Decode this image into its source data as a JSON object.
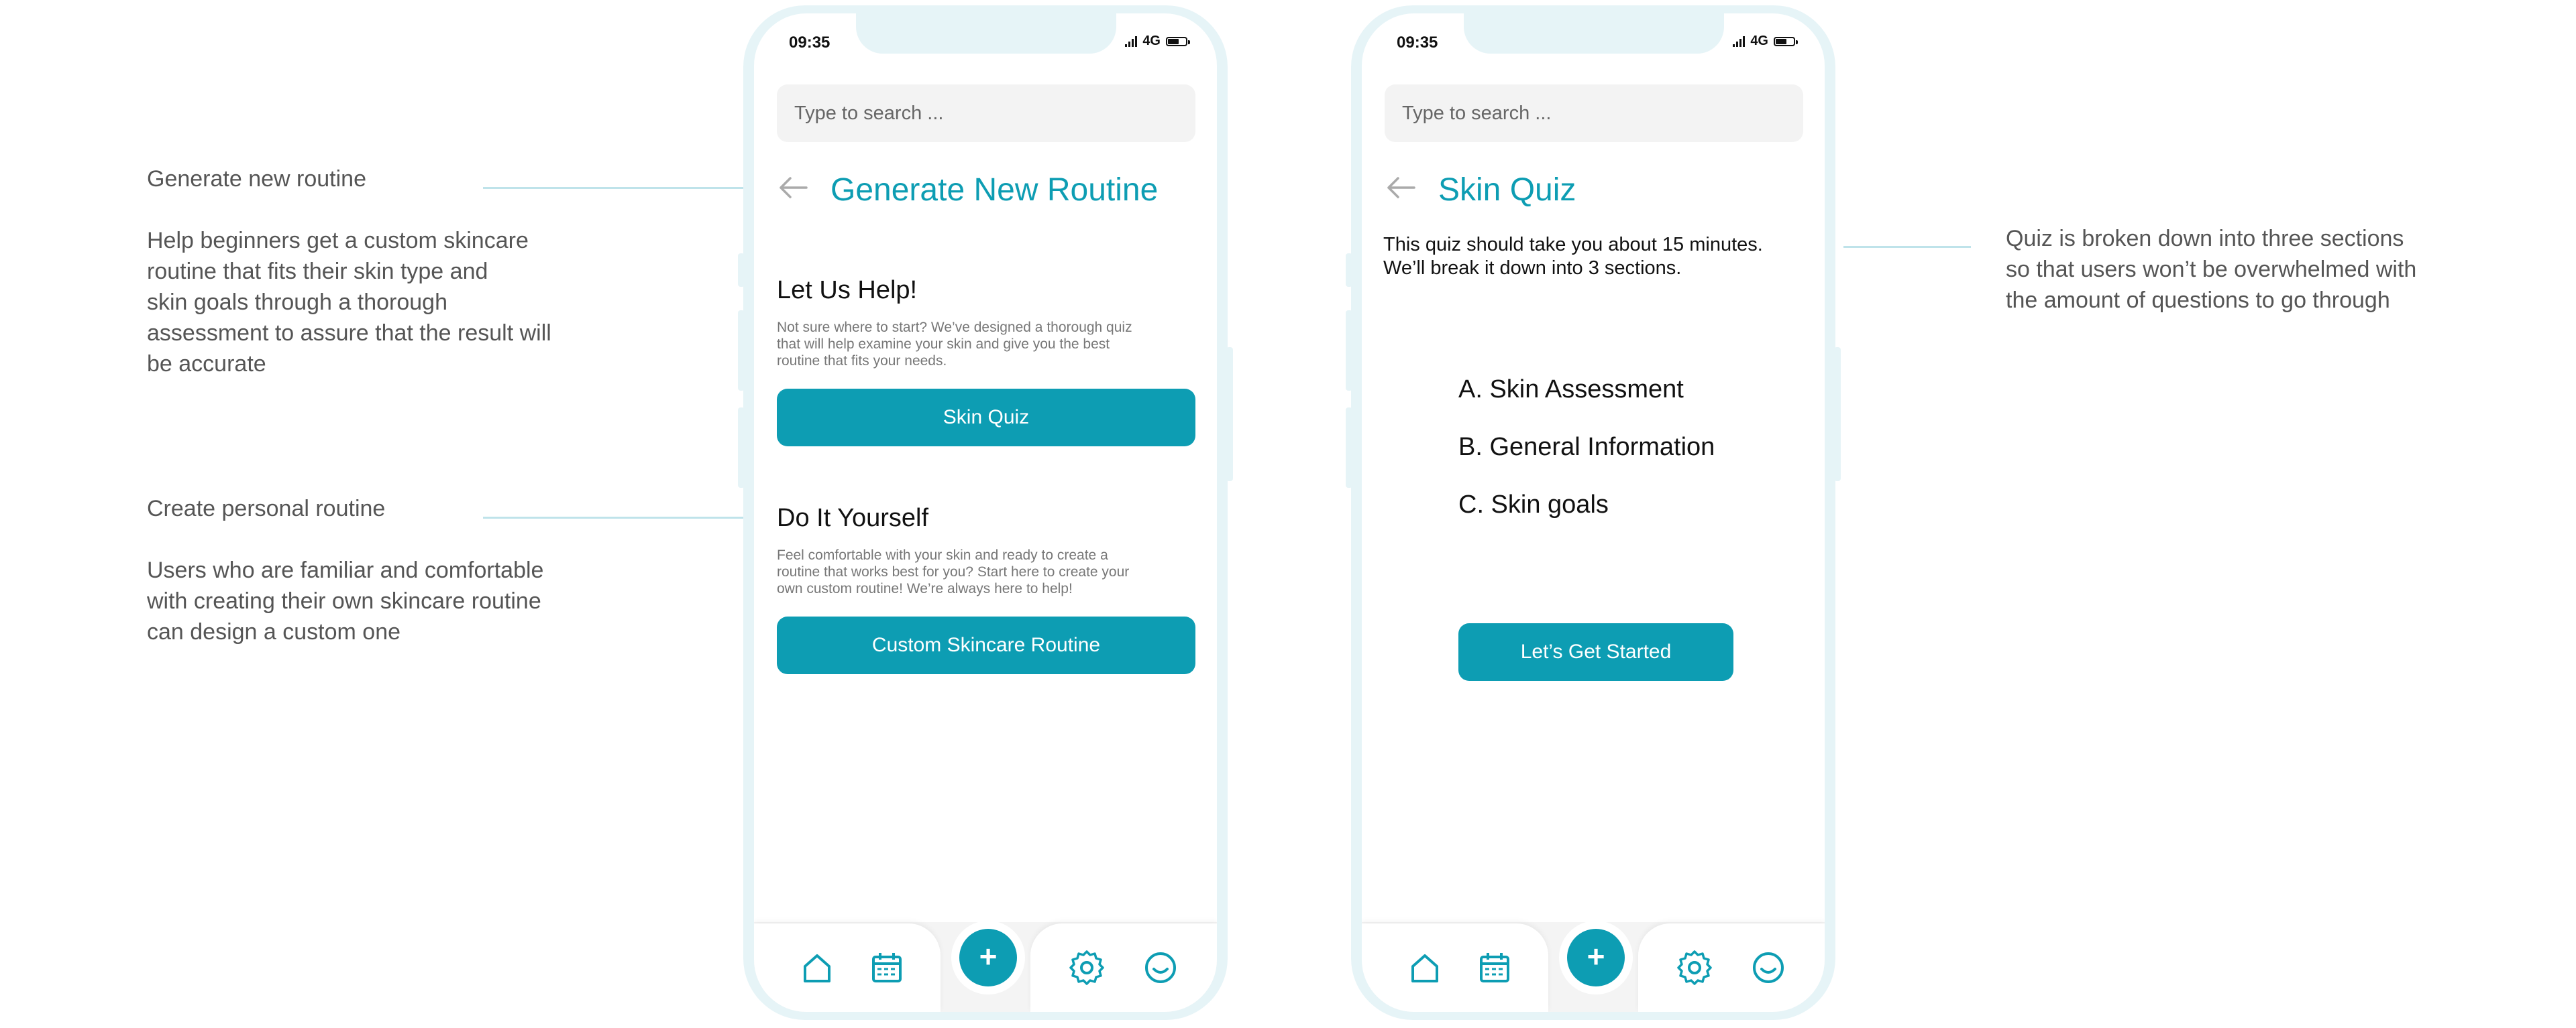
{
  "annotations": {
    "left": [
      {
        "title": "Generate new routine",
        "lines": [
          "Help beginners get a custom skincare",
          "routine that fits their skin type and",
          "skin goals through a thorough",
          "assessment to assure that the result will",
          "be accurate"
        ]
      },
      {
        "title": "Create personal routine",
        "lines": [
          "Users who are familiar and comfortable",
          "with creating their own skincare routine",
          "can design a custom one"
        ]
      }
    ],
    "right": {
      "lines": [
        "Quiz is broken down into three sections",
        "so that users won’t be overwhelmed with",
        "the amount of questions to go through"
      ]
    }
  },
  "status_bar": {
    "time": "09:35",
    "network": "4G"
  },
  "screen1": {
    "search_placeholder": "Type to search ...",
    "title": "Generate New Routine",
    "section1": {
      "heading": "Let Us Help!",
      "desc_lines": [
        "Not sure where to start? We’ve designed a thorough quiz",
        "that will help examine your skin and give you the best",
        "routine that fits your needs."
      ],
      "button": "Skin Quiz"
    },
    "section2": {
      "heading": "Do It Yourself",
      "desc_lines": [
        "Feel comfortable with your skin and ready to create a",
        "routine that works best for you? Start here to create your",
        "own custom routine! We’re always here to help!"
      ],
      "button": "Custom Skincare Routine"
    }
  },
  "screen2": {
    "search_placeholder": "Type to search ...",
    "title": "Skin Quiz",
    "intro_lines": [
      "This quiz should take you about 15 minutes.",
      "We’ll break it down into 3 sections."
    ],
    "sections": [
      "A. Skin Assessment",
      "B. General Information",
      "C. Skin goals"
    ],
    "button": "Let’s Get Started"
  },
  "tabbar": {
    "icons": [
      "home-icon",
      "calendar-icon",
      "plus-icon",
      "gear-icon",
      "smiley-icon"
    ],
    "fab_label": "+"
  },
  "colors": {
    "accent": "#0d9db3",
    "frame": "#e6f4f7",
    "leader": "#bfe3ea"
  }
}
